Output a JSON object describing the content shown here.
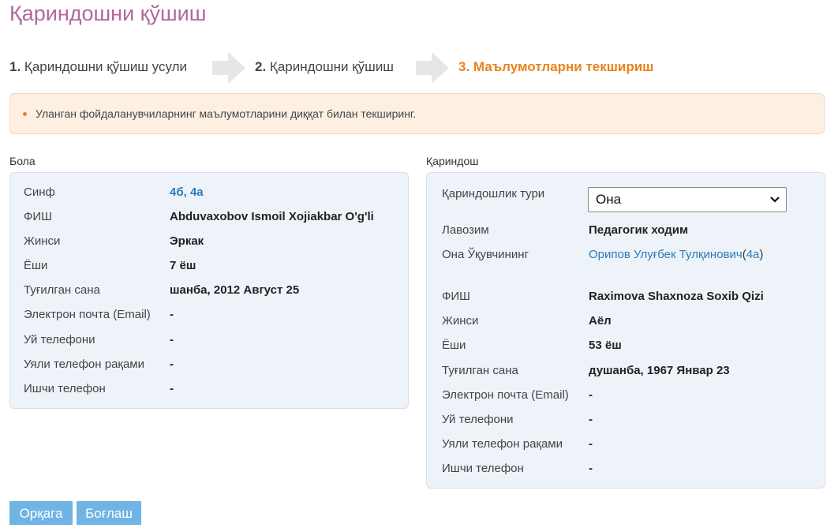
{
  "page": {
    "title": "Қариндошни қўшиш"
  },
  "steps": [
    {
      "num": "1.",
      "label": "Қариндошни қўшиш усули"
    },
    {
      "num": "2.",
      "label": "Қариндошни қўшиш"
    },
    {
      "num": "3.",
      "label": "Маълумотларни текшириш"
    }
  ],
  "alert": {
    "text": "Уланган фойдаланувчиларнинг маълумотларини диққат билан текширинг."
  },
  "child": {
    "section_label": "Бола",
    "class_label": "Синф",
    "class_values": [
      "4б",
      "4а"
    ],
    "class_sep": ", ",
    "fio_label": "ФИШ",
    "fio": "Abduvaxobov Ismoil Xojiakbar O'g'li",
    "gender_label": "Жинси",
    "gender": "Эркак",
    "age_label": "Ёши",
    "age": "7 ёш",
    "birth_label": "Туғилган сана",
    "birth": "шанба, 2012 Август 25",
    "email_label": "Электрон почта (Email)",
    "email": "-",
    "home_phone_label": "Уй телефони",
    "home_phone": "-",
    "mobile_label": "Уяли телефон рақами",
    "mobile": "-",
    "work_phone_label": "Ишчи телефон",
    "work_phone": "-"
  },
  "relative": {
    "section_label": "Қариндош",
    "relation_label": "Қариндошлик тури",
    "relation_value": "Она",
    "position_label": "Лавозим",
    "position": "Педагогик ходим",
    "mother_of_label": "Она Ўқувчининг",
    "mother_of_name": "Орипов Улуғбек Тулқинович",
    "mother_of_open": "(",
    "mother_of_class": "4а",
    "mother_of_close": ")",
    "fio_label": "ФИШ",
    "fio": "Raximova Shaxnoza Soxib Qizi",
    "gender_label": "Жинси",
    "gender": "Аёл",
    "age_label": "Ёши",
    "age": "53 ёш",
    "birth_label": "Туғилган сана",
    "birth": "душанба, 1967 Январ 23",
    "email_label": "Электрон почта (Email)",
    "email": "-",
    "home_phone_label": "Уй телефони",
    "home_phone": "-",
    "mobile_label": "Уяли телефон рақами",
    "mobile": "-",
    "work_phone_label": "Ишчи телефон",
    "work_phone": "-"
  },
  "buttons": {
    "back": "Орқага",
    "link": "Боғлаш"
  },
  "colors": {
    "title": "#b0689a",
    "active_step": "#e8821e",
    "link": "#2a7ab8",
    "button": "#6fb4e4"
  }
}
